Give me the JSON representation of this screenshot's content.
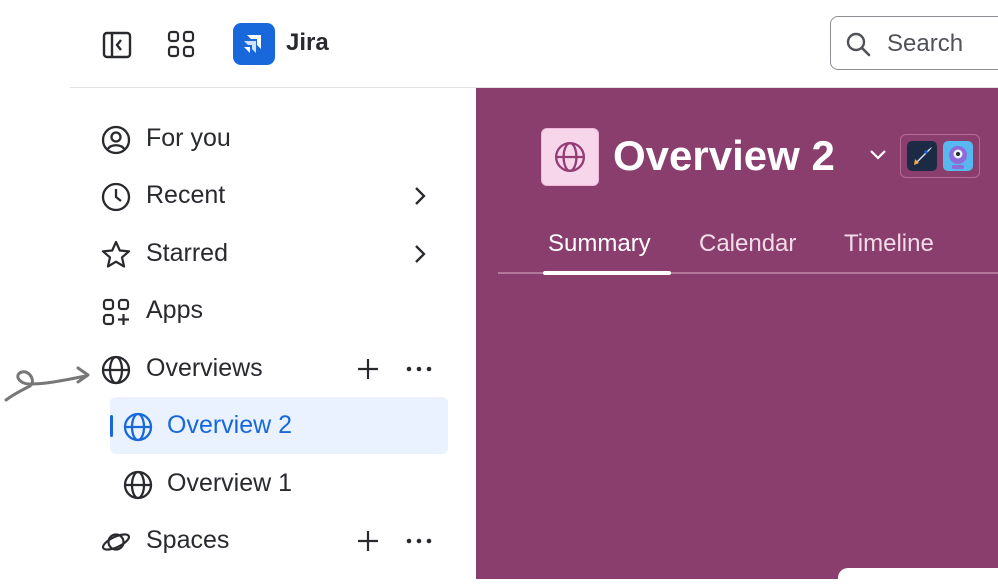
{
  "header": {
    "app_name": "Jira",
    "search_placeholder": "Search",
    "icons": [
      "sidebar-toggle-icon",
      "app-switcher-icon",
      "jira-logo-icon",
      "search-icon"
    ]
  },
  "sidebar": {
    "items": [
      {
        "label": "For you",
        "icon": "person-circle-icon"
      },
      {
        "label": "Recent",
        "icon": "clock-icon"
      },
      {
        "label": "Starred",
        "icon": "star-icon"
      },
      {
        "label": "Apps",
        "icon": "apps-icon"
      },
      {
        "label": "Overviews",
        "icon": "globe-icon"
      },
      {
        "label": "Overview 2",
        "icon": "globe-icon",
        "selected": true
      },
      {
        "label": "Overview 1",
        "icon": "globe-icon"
      },
      {
        "label": "Spaces",
        "icon": "planet-icon"
      }
    ]
  },
  "main": {
    "title": "Overview 2",
    "tabs": [
      "Summary",
      "Calendar",
      "Timeline"
    ],
    "active_tab": "Summary",
    "background_color": "#8a3e6d"
  },
  "colors": {
    "accent": "#1868db",
    "selected_bg": "#e9f2fe",
    "project_bg": "#8a3e6d"
  }
}
